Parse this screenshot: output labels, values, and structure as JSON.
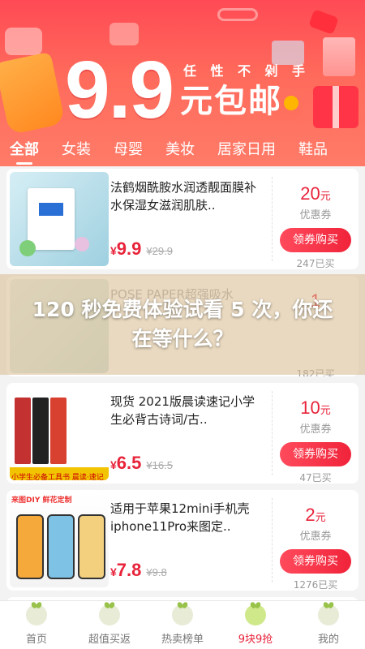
{
  "banner": {
    "slogan": [
      "任",
      "性",
      "不",
      "剁",
      "手"
    ],
    "price_big": "9.9",
    "price_suffix": "元包邮"
  },
  "tabs": [
    "全部",
    "女装",
    "母婴",
    "美妆",
    "居家日用",
    "鞋品"
  ],
  "active_tab": "全部",
  "products": [
    {
      "title": "法鹤烟酰胺水润透靓面膜补水保湿女滋润肌肤..",
      "currency": "¥",
      "price": "9.9",
      "original_price": "¥29.9",
      "coupon_value": "20",
      "coupon_unit": "元",
      "coupon_label": "优惠券",
      "button": "领券购买",
      "sold": "247已买"
    },
    {
      "title": "POSE PAPER超强吸水",
      "sold": "182已买",
      "coupon_value": "1"
    },
    {
      "title": "现货 2021版晨读速记小学生必背古诗词/古..",
      "currency": "¥",
      "price": "6.5",
      "original_price": "¥16.5",
      "coupon_value": "10",
      "coupon_unit": "元",
      "coupon_label": "优惠券",
      "button": "领券购买",
      "sold": "47已买",
      "thumb_caption": "小学生必备工具书 晨读·速记"
    },
    {
      "title": "适用于苹果12mini手机壳iphone11Pro来图定..",
      "currency": "¥",
      "price": "7.8",
      "original_price": "¥9.8",
      "coupon_value": "2",
      "coupon_unit": "元",
      "coupon_label": "优惠券",
      "button": "领券购买",
      "sold": "1276已买",
      "thumb_caption": "来图DIY 鲜花定制"
    }
  ],
  "overlay": {
    "text": "120 秒免费体验试看 5 次，你还在等什么？"
  },
  "bottom_nav": [
    {
      "label": "首页",
      "active": false
    },
    {
      "label": "超值买返",
      "active": false
    },
    {
      "label": "热卖榜单",
      "active": false
    },
    {
      "label": "9块9抢",
      "active": true
    },
    {
      "label": "我的",
      "active": false
    }
  ],
  "colors": {
    "accent": "#e8233a",
    "banner": "#ff4a55",
    "overlay": "#d7b98c"
  }
}
